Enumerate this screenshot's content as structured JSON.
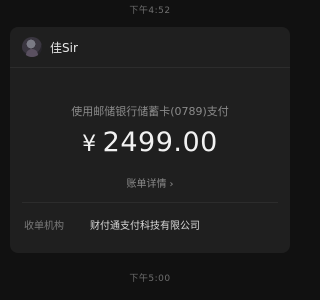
{
  "timestamps": {
    "top": "下午4:52",
    "bottom": "下午5:00"
  },
  "card": {
    "sender": {
      "name": "佳Sir",
      "avatar_icon": "avatar-photo"
    },
    "payment_description": "使用邮储银行储蓄卡(0789)支付",
    "currency_symbol": "¥",
    "amount": "2499.00",
    "detail_link": {
      "label": "账单详情",
      "icon": "chevron-right-icon"
    },
    "info": {
      "label": "收单机构",
      "value": "财付通支付科技有限公司"
    }
  },
  "colors": {
    "background": "#111111",
    "card": "#1f1f1f",
    "primary_text": "#f2f2f2",
    "secondary_text": "#8a8a8a"
  }
}
